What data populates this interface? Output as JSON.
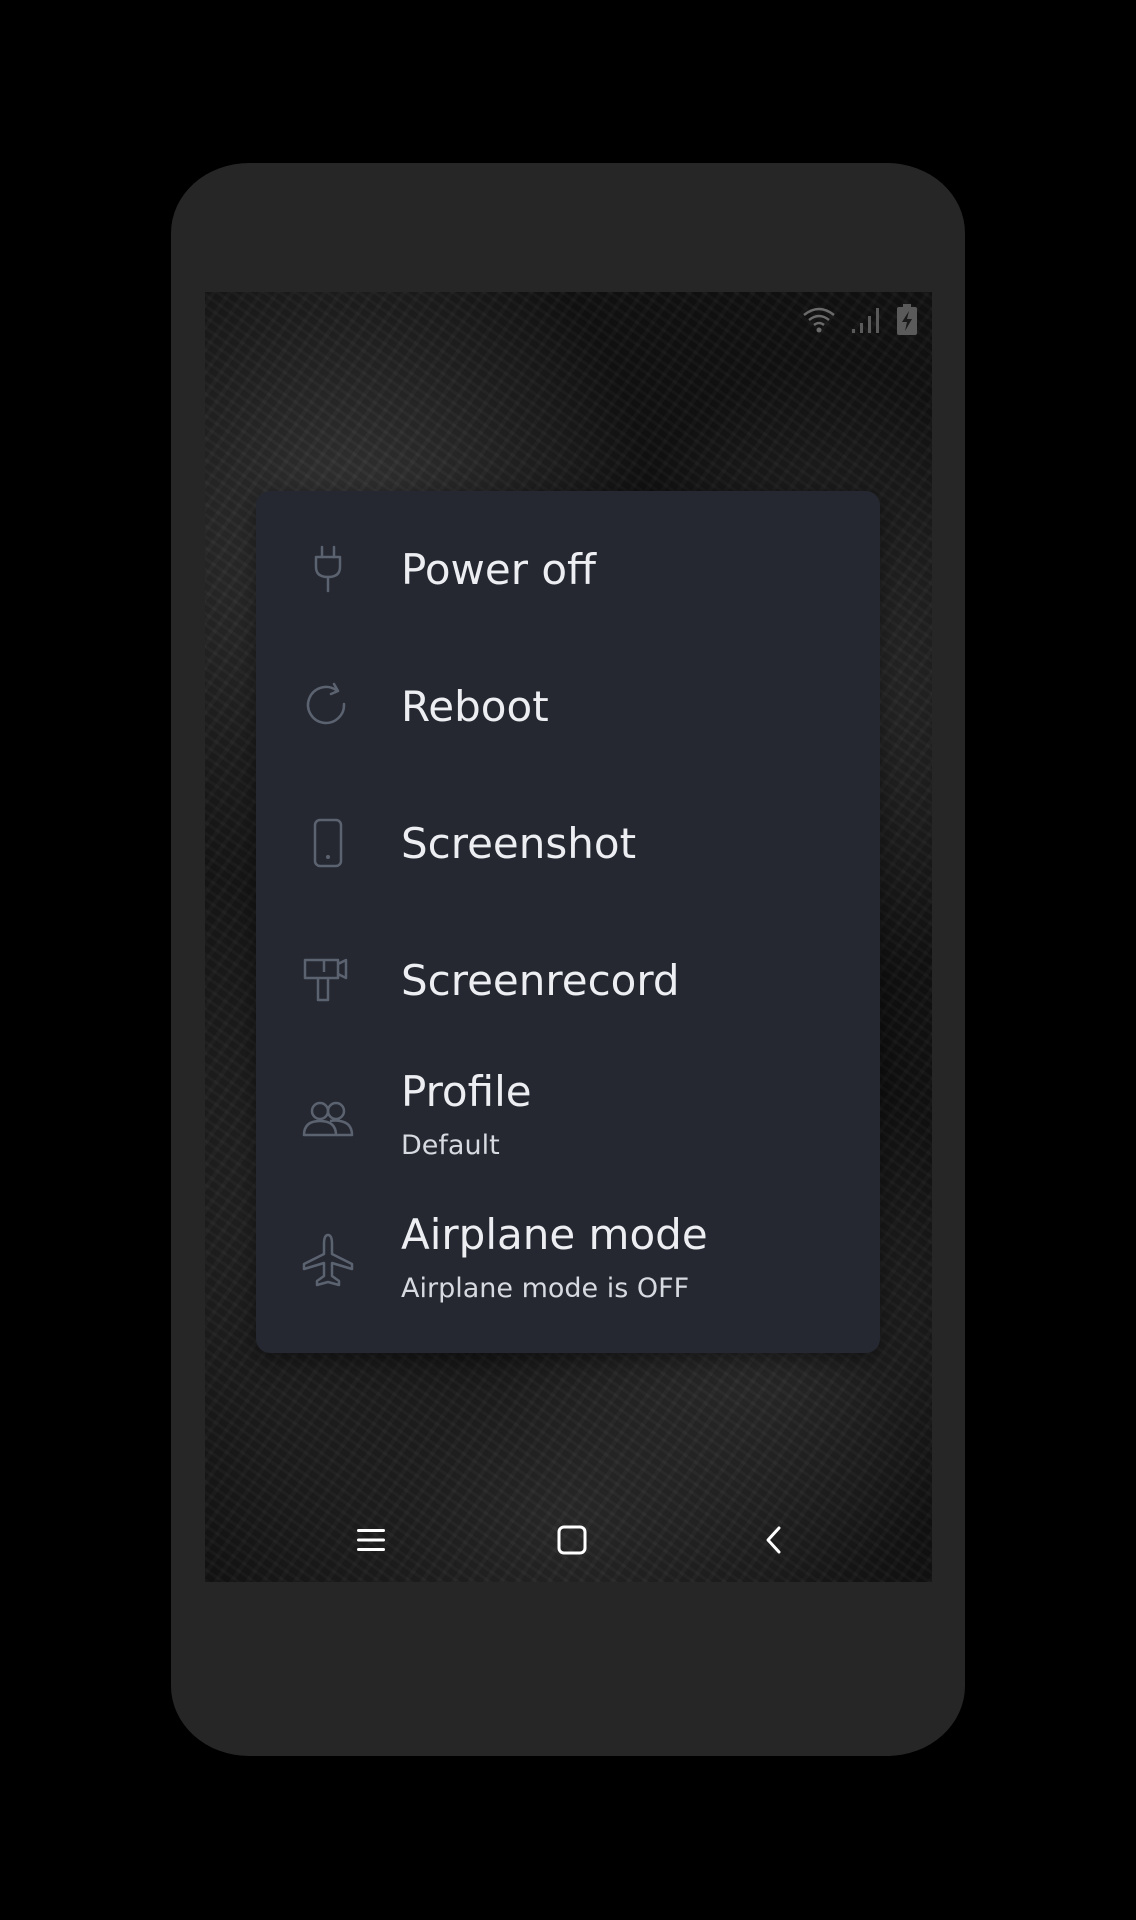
{
  "status_bar": {
    "icons": [
      "wifi-icon",
      "cellular-signal-icon",
      "battery-charging-icon"
    ]
  },
  "power_menu": {
    "items": [
      {
        "label": "Power off",
        "sublabel": "",
        "icon": "plug-icon"
      },
      {
        "label": "Reboot",
        "sublabel": "",
        "icon": "refresh-icon"
      },
      {
        "label": "Screenshot",
        "sublabel": "",
        "icon": "phone-icon"
      },
      {
        "label": "Screenrecord",
        "sublabel": "",
        "icon": "camera-icon"
      },
      {
        "label": "Profile",
        "sublabel": "Default",
        "icon": "users-icon"
      },
      {
        "label": "Airplane mode",
        "sublabel": "Airplane mode is OFF",
        "icon": "airplane-icon"
      }
    ]
  },
  "nav_bar": {
    "icons": [
      "menu-icon",
      "home-icon",
      "back-icon"
    ]
  },
  "colors": {
    "menu_background": "#252831",
    "device_frame": "#262626",
    "icon_stroke": "#5c6370",
    "text_primary": "#eceef2"
  }
}
